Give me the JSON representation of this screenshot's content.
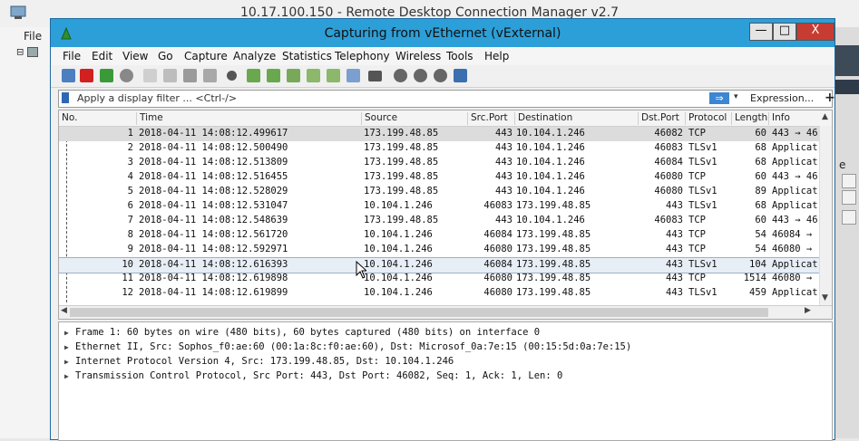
{
  "outer": {
    "title": "10.17.100.150 - Remote Desktop Connection Manager v2.7",
    "menu_file": "File",
    "tree_node": "⊟",
    "right_edge_text": "e"
  },
  "window": {
    "title": "Capturing from vEthernet (vExternal)",
    "btn_minimize": "—",
    "btn_maximize": "□",
    "btn_close": "X"
  },
  "menu": [
    "File",
    "Edit",
    "View",
    "Go",
    "Capture",
    "Analyze",
    "Statistics",
    "Telephony",
    "Wireless",
    "Tools",
    "Help"
  ],
  "filter": {
    "placeholder": "Apply a display filter ... <Ctrl-/>",
    "apply_glyph": "⇒",
    "dropdown_glyph": "▾",
    "expression_label": "Expression...",
    "add_label": "+"
  },
  "columns": [
    "No.",
    "Time",
    "Source",
    "Src.Port",
    "Destination",
    "Dst.Port",
    "Protocol",
    "Length",
    "Info"
  ],
  "packets": [
    {
      "no": "1",
      "time": "2018-04-11 14:08:12.499617",
      "src": "173.199.48.85",
      "sport": "443",
      "dst": "10.104.1.246",
      "dport": "46082",
      "proto": "TCP",
      "len": "60",
      "info": "443 → 46"
    },
    {
      "no": "2",
      "time": "2018-04-11 14:08:12.500490",
      "src": "173.199.48.85",
      "sport": "443",
      "dst": "10.104.1.246",
      "dport": "46083",
      "proto": "TLSv1",
      "len": "68",
      "info": "Applicat"
    },
    {
      "no": "3",
      "time": "2018-04-11 14:08:12.513809",
      "src": "173.199.48.85",
      "sport": "443",
      "dst": "10.104.1.246",
      "dport": "46084",
      "proto": "TLSv1",
      "len": "68",
      "info": "Applicat"
    },
    {
      "no": "4",
      "time": "2018-04-11 14:08:12.516455",
      "src": "173.199.48.85",
      "sport": "443",
      "dst": "10.104.1.246",
      "dport": "46080",
      "proto": "TCP",
      "len": "60",
      "info": "443 → 46"
    },
    {
      "no": "5",
      "time": "2018-04-11 14:08:12.528029",
      "src": "173.199.48.85",
      "sport": "443",
      "dst": "10.104.1.246",
      "dport": "46080",
      "proto": "TLSv1",
      "len": "89",
      "info": "Applicat"
    },
    {
      "no": "6",
      "time": "2018-04-11 14:08:12.531047",
      "src": "10.104.1.246",
      "sport": "46083",
      "dst": "173.199.48.85",
      "dport": "443",
      "proto": "TLSv1",
      "len": "68",
      "info": "Applicat"
    },
    {
      "no": "7",
      "time": "2018-04-11 14:08:12.548639",
      "src": "173.199.48.85",
      "sport": "443",
      "dst": "10.104.1.246",
      "dport": "46083",
      "proto": "TCP",
      "len": "60",
      "info": "443 → 46"
    },
    {
      "no": "8",
      "time": "2018-04-11 14:08:12.561720",
      "src": "10.104.1.246",
      "sport": "46084",
      "dst": "173.199.48.85",
      "dport": "443",
      "proto": "TCP",
      "len": "54",
      "info": "46084 →"
    },
    {
      "no": "9",
      "time": "2018-04-11 14:08:12.592971",
      "src": "10.104.1.246",
      "sport": "46080",
      "dst": "173.199.48.85",
      "dport": "443",
      "proto": "TCP",
      "len": "54",
      "info": "46080 →"
    },
    {
      "no": "10",
      "time": "2018-04-11 14:08:12.616393",
      "src": "10.104.1.246",
      "sport": "46084",
      "dst": "173.199.48.85",
      "dport": "443",
      "proto": "TLSv1",
      "len": "104",
      "info": "Applicat"
    },
    {
      "no": "11",
      "time": "2018-04-11 14:08:12.619898",
      "src": "10.104.1.246",
      "sport": "46080",
      "dst": "173.199.48.85",
      "dport": "443",
      "proto": "TCP",
      "len": "1514",
      "info": "46080 →"
    },
    {
      "no": "12",
      "time": "2018-04-11 14:08:12.619899",
      "src": "10.104.1.246",
      "sport": "46080",
      "dst": "173.199.48.85",
      "dport": "443",
      "proto": "TLSv1",
      "len": "459",
      "info": "Applicat"
    }
  ],
  "details": [
    "Frame 1: 60 bytes on wire (480 bits), 60 bytes captured (480 bits) on interface 0",
    "Ethernet II, Src: Sophos_f0:ae:60 (00:1a:8c:f0:ae:60), Dst: Microsof_0a:7e:15 (00:15:5d:0a:7e:15)",
    "Internet Protocol Version 4, Src: 173.199.48.85, Dst: 10.104.1.246",
    "Transmission Control Protocol, Src Port: 443, Dst Port: 46082, Seq: 1, Ack: 1, Len: 0"
  ],
  "colors": {
    "titlebar": "#2c9fd8",
    "close": "#c73c32",
    "stop": "#d02020",
    "start": "#3a9a3a"
  },
  "toolbar_icons": [
    "start-capture-icon",
    "stop-capture-icon",
    "restart-capture-icon",
    "capture-options-icon",
    "open-file-icon",
    "save-file-icon",
    "close-file-icon",
    "reload-icon",
    "find-icon",
    "go-back-icon",
    "go-forward-icon",
    "go-to-packet-icon",
    "go-first-icon",
    "go-last-icon",
    "autoscroll-icon",
    "colorize-icon",
    "zoom-in-icon",
    "zoom-out-icon",
    "zoom-normal-icon",
    "resize-columns-icon"
  ]
}
